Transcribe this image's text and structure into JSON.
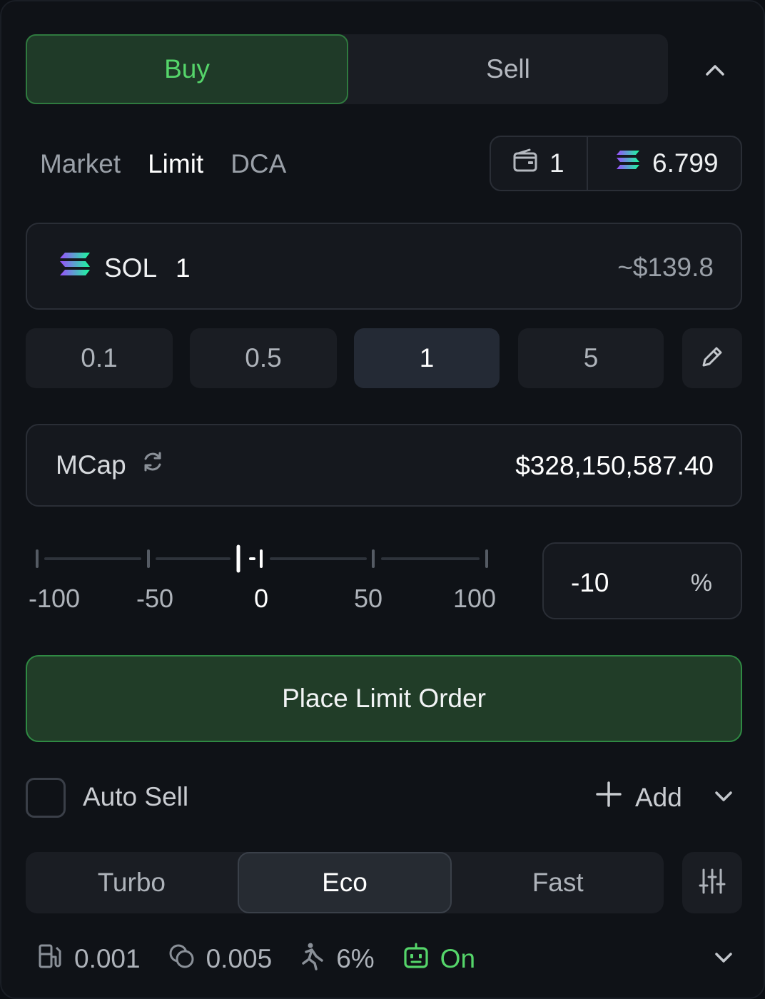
{
  "side": {
    "buy": "Buy",
    "sell": "Sell",
    "active": "Buy"
  },
  "order_types": {
    "market": "Market",
    "limit": "Limit",
    "dca": "DCA",
    "active": "Limit"
  },
  "wallet": {
    "count": "1",
    "sol_balance": "6.799"
  },
  "amount": {
    "token": "SOL",
    "value": "1",
    "usd": "~$139.8"
  },
  "presets": [
    "0.1",
    "0.5",
    "1",
    "5"
  ],
  "preset_active": "1",
  "mcap": {
    "label": "MCap",
    "value": "$328,150,587.40"
  },
  "slider": {
    "ticks": [
      "-100",
      "-50",
      "0",
      "50",
      "100"
    ],
    "value_percent": -10
  },
  "percent": {
    "value": "-10",
    "unit": "%"
  },
  "place_order": "Place Limit Order",
  "auto_sell": {
    "label": "Auto Sell",
    "add": "Add",
    "checked": false
  },
  "speed": {
    "turbo": "Turbo",
    "eco": "Eco",
    "fast": "Fast",
    "active": "Eco"
  },
  "footer": {
    "gas": "0.001",
    "priority": "0.005",
    "slippage": "6%",
    "mev": "On"
  },
  "colors": {
    "accent_green": "#55d56a",
    "button_green": "#213d28",
    "border_green": "#2f8a43"
  }
}
